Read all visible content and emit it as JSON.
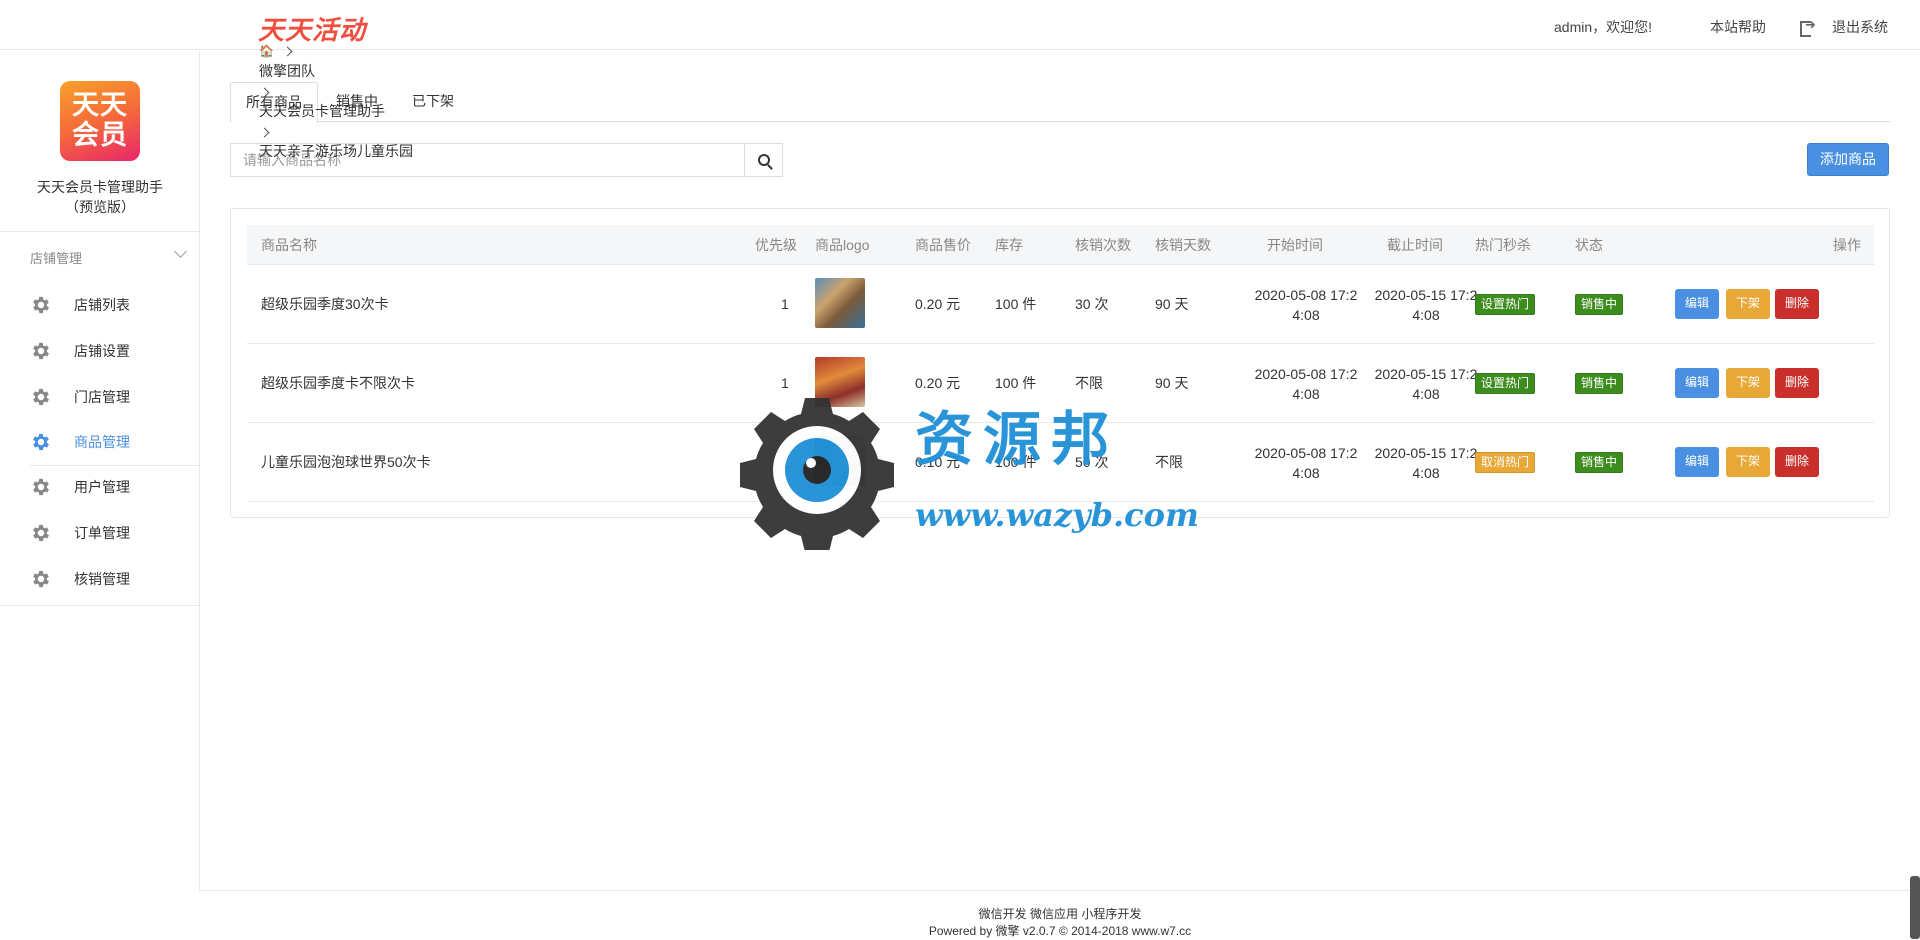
{
  "header": {
    "brand": "天天活动",
    "user_greeting": "admin，欢迎您!",
    "help_label": "本站帮助",
    "exit_label": "退出系统"
  },
  "sidebar": {
    "logo_text_line1": "天天",
    "logo_text_line2": "会员",
    "app_name": "天天会员卡管理助手",
    "app_edition": "（预览版）",
    "group_label": "店铺管理",
    "items": [
      {
        "label": "店铺列表"
      },
      {
        "label": "店铺设置"
      },
      {
        "label": "门店管理"
      },
      {
        "label": "商品管理"
      },
      {
        "label": "用户管理"
      },
      {
        "label": "订单管理"
      },
      {
        "label": "核销管理"
      }
    ]
  },
  "breadcrumb": {
    "items": [
      "微擎团队",
      "天天会员卡管理助手",
      "天天亲子游乐场儿童乐园"
    ]
  },
  "tabs": [
    {
      "label": "所有商品",
      "active": true
    },
    {
      "label": "销售中",
      "active": false
    },
    {
      "label": "已下架",
      "active": false
    }
  ],
  "search": {
    "placeholder": "请输入商品名称",
    "value": ""
  },
  "add_button_label": "添加商品",
  "table": {
    "headers": [
      "商品名称",
      "优先级",
      "商品logo",
      "商品售价",
      "库存",
      "核销次数",
      "核销天数",
      "开始时间",
      "截止时间",
      "热门秒杀",
      "状态",
      "操作"
    ],
    "rows": [
      {
        "name": "超级乐园季度30次卡",
        "priority": "1",
        "price": "0.20 元",
        "stock": "100 件",
        "verify_count": "30 次",
        "verify_days": "90 天",
        "start_l1": "2020-05-08 17:2",
        "start_l2": "4:08",
        "end_l1": "2020-05-15 17:2",
        "end_l2": "4:08",
        "hot_label": "设置热门",
        "hot_color": "#3c8c1e",
        "status_label": "销售中",
        "status_color": "#3c8c1e"
      },
      {
        "name": "超级乐园季度卡不限次卡",
        "priority": "1",
        "price": "0.20 元",
        "stock": "100 件",
        "verify_count": "不限",
        "verify_days": "90 天",
        "start_l1": "2020-05-08 17:2",
        "start_l2": "4:08",
        "end_l1": "2020-05-15 17:2",
        "end_l2": "4:08",
        "hot_label": "设置热门",
        "hot_color": "#3c8c1e",
        "status_label": "销售中",
        "status_color": "#3c8c1e"
      },
      {
        "name": "儿童乐园泡泡球世界50次卡",
        "priority": "1",
        "price": "0.10 元",
        "stock": "100 件",
        "verify_count": "50 次",
        "verify_days": "不限",
        "start_l1": "2020-05-08 17:2",
        "start_l2": "4:08",
        "end_l1": "2020-05-15 17:2",
        "end_l2": "4:08",
        "hot_label": "取消热门",
        "hot_color": "#e8a838",
        "status_label": "销售中",
        "status_color": "#3c8c1e"
      }
    ],
    "actions": {
      "edit": "编辑",
      "offshelf": "下架",
      "delete": "删除"
    }
  },
  "watermark": {
    "title": "资源邦",
    "url": "www.wazyb.com"
  },
  "footer": {
    "line1": "微信开发 微信应用 小程序开发",
    "line2": "Powered by 微擎 v2.0.7 © 2014-2018 www.w7.cc"
  },
  "colors": {
    "accent": "#4a90e2",
    "success": "#3c8c1e",
    "warning": "#e8a838",
    "danger": "#c9302c"
  }
}
